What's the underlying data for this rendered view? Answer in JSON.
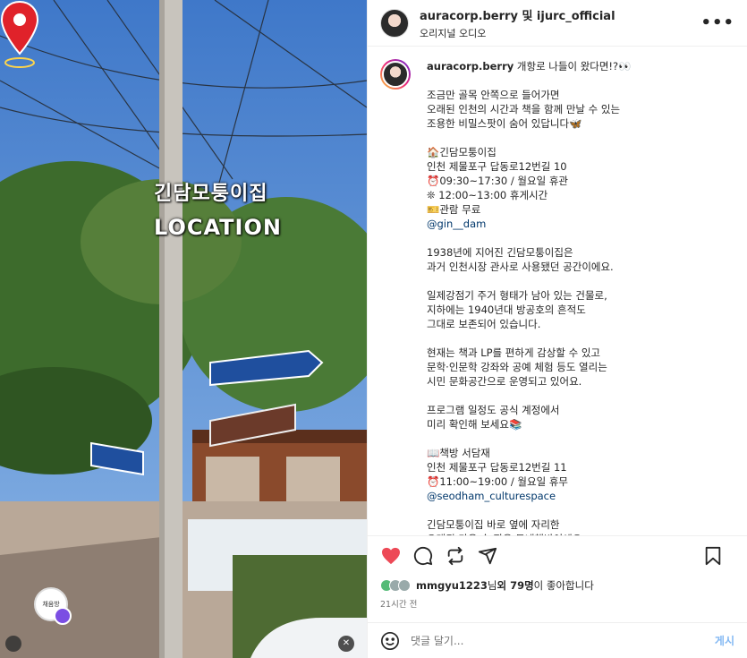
{
  "overlay": {
    "title": "긴담모퉁이집",
    "location": "LOCATION"
  },
  "header": {
    "user": "auracorp.berry 및 ijurc_official",
    "audio": "오리지널 오디오",
    "more": "•••"
  },
  "caption": {
    "username": "auracorp.berry",
    "lines": [
      "개항로 나들이 왔다면!?👀",
      "",
      "조금만 골목 안쪽으로 들어가면",
      "오래된 인천의 시간과 책을 함께 만날 수 있는",
      "조용한 비밀스팟이 숨어 있답니다🦋",
      "",
      "🏠긴담모퉁이집",
      "인천 제물포구 답동로12번길 10",
      "⏰09:30~17:30 / 월요일 휴관",
      "❊ 12:00~13:00 휴게시간",
      "🎫관람 무료",
      "@gin__dam",
      "",
      "1938년에 지어진 긴담모퉁이집은",
      "과거 인천시장 관사로 사용됐던 공간이에요.",
      "",
      "일제강점기 주거 형태가 남아 있는 건물로,",
      "지하에는 1940년대 방공호의 흔적도",
      "그대로 보존되어 있습니다.",
      "",
      "현재는 책과 LP를 편하게 감상할 수 있고",
      "문학·인문학 강좌와 공예 체험 등도 열리는",
      "시민 문화공간으로 운영되고 있어요.",
      "",
      "프로그램 일정도 공식 계정에서",
      "미리 확인해 보세요📚",
      "",
      "📖책방 서담재",
      "인천 제물포구 답동로12번길 11",
      "⏰11:00~19:00 / 월요일 휴무",
      "@seodham_culturespace",
      "",
      "긴담모퉁이집 바로 옆에 자리한",
      "오래된 가옥 속 작은 동네책방이에요."
    ]
  },
  "likes": {
    "user": "mmgyu1223",
    "suffix1": "님 ",
    "count": "외 79명",
    "suffix2": "이 좋아합니다"
  },
  "time": "21시간 전",
  "comment": {
    "placeholder": "댓글 달기...",
    "post": "게시"
  },
  "photo_badge": "채움방",
  "colors": {
    "like": "#ed4956",
    "link": "#00376b",
    "post": "#82b8f3"
  }
}
